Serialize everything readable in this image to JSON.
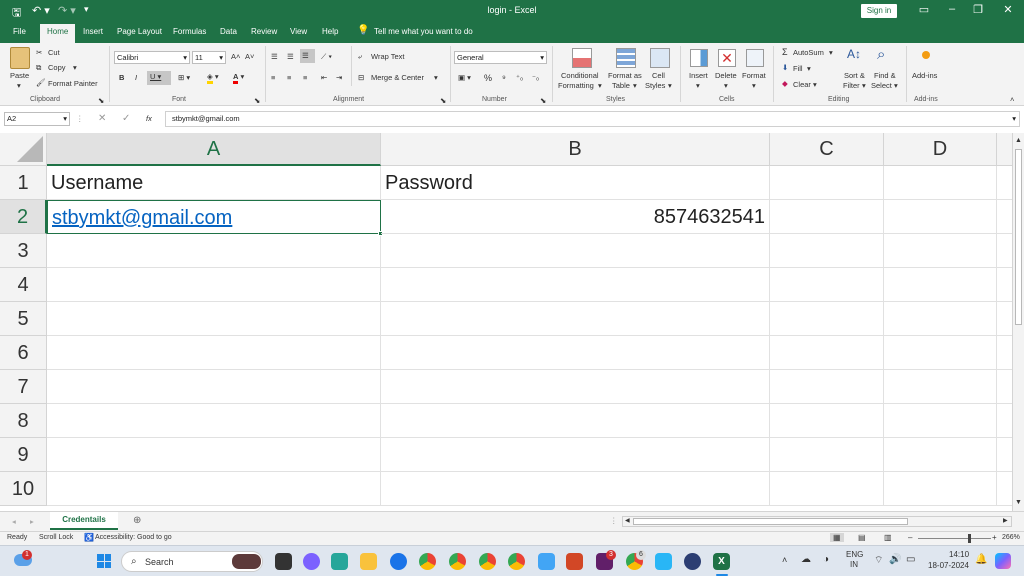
{
  "titlebar": {
    "title": "login  -  Excel",
    "sign_in": "Sign in",
    "save_icon": "save-icon",
    "undo_icon": "undo-icon",
    "redo_icon": "redo-icon"
  },
  "tabs": [
    "File",
    "Home",
    "Insert",
    "Page Layout",
    "Formulas",
    "Data",
    "Review",
    "View",
    "Help"
  ],
  "tell_me": "Tell me what you want to do",
  "ribbon": {
    "clipboard": {
      "paste": "Paste",
      "cut": "Cut",
      "copy": "Copy",
      "format_painter": "Format Painter",
      "group": "Clipboard"
    },
    "font": {
      "name": "Calibri",
      "size": "11",
      "group": "Font"
    },
    "alignment": {
      "wrap": "Wrap Text",
      "merge": "Merge & Center",
      "group": "Alignment"
    },
    "number": {
      "format": "General",
      "group": "Number"
    },
    "styles": {
      "conditional_1": "Conditional",
      "conditional_2": "Formatting",
      "format_table_1": "Format as",
      "format_table_2": "Table",
      "cell_styles_1": "Cell",
      "cell_styles_2": "Styles",
      "group": "Styles"
    },
    "cells": {
      "insert": "Insert",
      "delete": "Delete",
      "format": "Format",
      "group": "Cells"
    },
    "editing": {
      "autosum": "AutoSum",
      "fill": "Fill",
      "clear": "Clear",
      "sort_1": "Sort &",
      "sort_2": "Filter",
      "find_1": "Find &",
      "find_2": "Select",
      "group": "Editing"
    },
    "addins": {
      "label": "Add-ins",
      "group": "Add-ins"
    }
  },
  "formula_bar": {
    "name_box": "A2",
    "fx": "fx",
    "value": "stbymkt@gmail.com"
  },
  "grid": {
    "columns": [
      "A",
      "B",
      "C",
      "D"
    ],
    "rows": [
      "1",
      "2",
      "3",
      "4",
      "5",
      "6",
      "7",
      "8",
      "9",
      "10"
    ],
    "cells": {
      "A1": "Username",
      "B1": "Password",
      "A2": "stbymkt@gmail.com",
      "B2": "8574632541"
    },
    "link_color": "#0563c1",
    "accent": "#1f7246"
  },
  "sheet_tab": "Credentails",
  "status": {
    "ready": "Ready",
    "scroll_lock": "Scroll Lock",
    "accessibility": "Accessibility: Good to go",
    "zoom": "266%"
  },
  "taskbar": {
    "search": "Search",
    "lang_1": "ENG",
    "lang_2": "IN",
    "time": "14:10",
    "date": "18-07-2024",
    "badge_1": "1",
    "badge_2": "3",
    "badge_3": "6"
  }
}
